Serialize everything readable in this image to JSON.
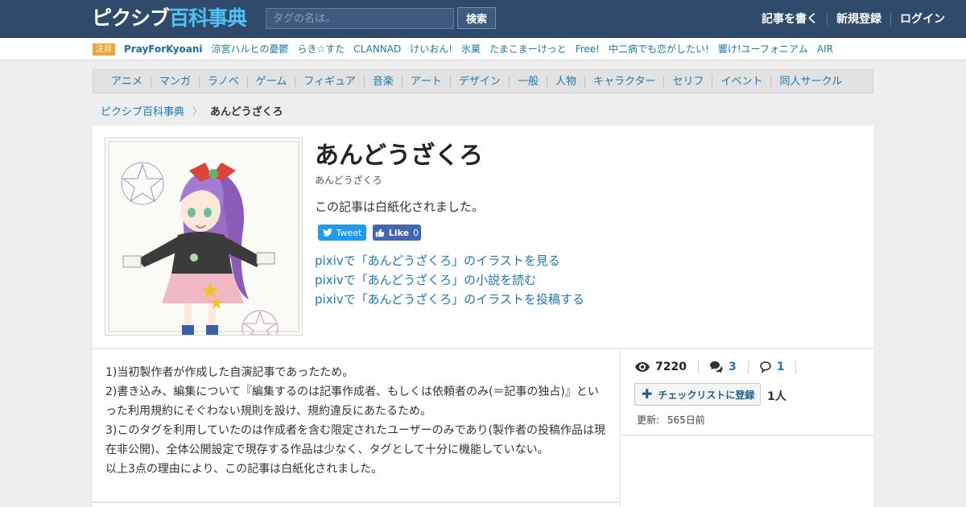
{
  "header": {
    "logo_main": "ピクシブ",
    "logo_accent": "百科事典",
    "search_placeholder": "タグの名は。",
    "search_button": "検索",
    "nav": [
      "記事を書く",
      "新規登録",
      "ログイン"
    ]
  },
  "trending": {
    "badge": "注目",
    "items": [
      "PrayForKyoani",
      "涼宮ハルヒの憂鬱",
      "らき☆すた",
      "CLANNAD",
      "けいおん!",
      "氷菓",
      "たまこまーけっと",
      "Free!",
      "中二病でも恋がしたい!",
      "響け!ユーフォニアム",
      "AIR"
    ]
  },
  "categories": [
    "アニメ",
    "マンガ",
    "ラノベ",
    "ゲーム",
    "フィギュア",
    "音楽",
    "アート",
    "デザイン",
    "一般",
    "人物",
    "キャラクター",
    "セリフ",
    "イベント",
    "同人サークル"
  ],
  "breadcrumb": {
    "root": "ピクシブ百科事典",
    "current": "あんどうざくろ"
  },
  "article": {
    "title": "あんどうざくろ",
    "reading": "あんどうざくろ",
    "summary": "この記事は白紙化されました。",
    "tweet_label": "Tweet",
    "like_label": "Like",
    "like_count": "0",
    "pixiv_links": [
      "pixivで「あんどうざくろ」のイラストを見る",
      "pixivで「あんどうざくろ」の小説を読む",
      "pixivで「あんどうざくろ」のイラストを投稿する"
    ]
  },
  "body": {
    "paragraphs": [
      "1)当初製作者が作成した自演記事であったため。",
      "2)書き込み、編集について『編集するのは記事作成者、もしくは依頼者のみ(＝記事の独占)』といった利用規約にそぐわない規則を設け、規約違反にあたるため。",
      "3)このタグを利用していたのは作成者を含む限定されたユーザーのみであり(製作者の投稿作品は現在非公開)、全体公開設定で現存する作品は少なく、タグとして十分に機能していない。",
      "以上3点の理由により、この記事は白紙化されました。"
    ]
  },
  "stats": {
    "views": "7220",
    "comments": "3",
    "replies": "1",
    "checklist_label": "チェックリストに登録",
    "checklist_count": "1人",
    "updated_label": "更新:",
    "updated_value": "565日前"
  },
  "colors": {
    "header_bg": "#2f4a6b",
    "link": "#1b7ab2",
    "logo_accent": "#4fc1f0",
    "badge": "#f2a33a"
  }
}
